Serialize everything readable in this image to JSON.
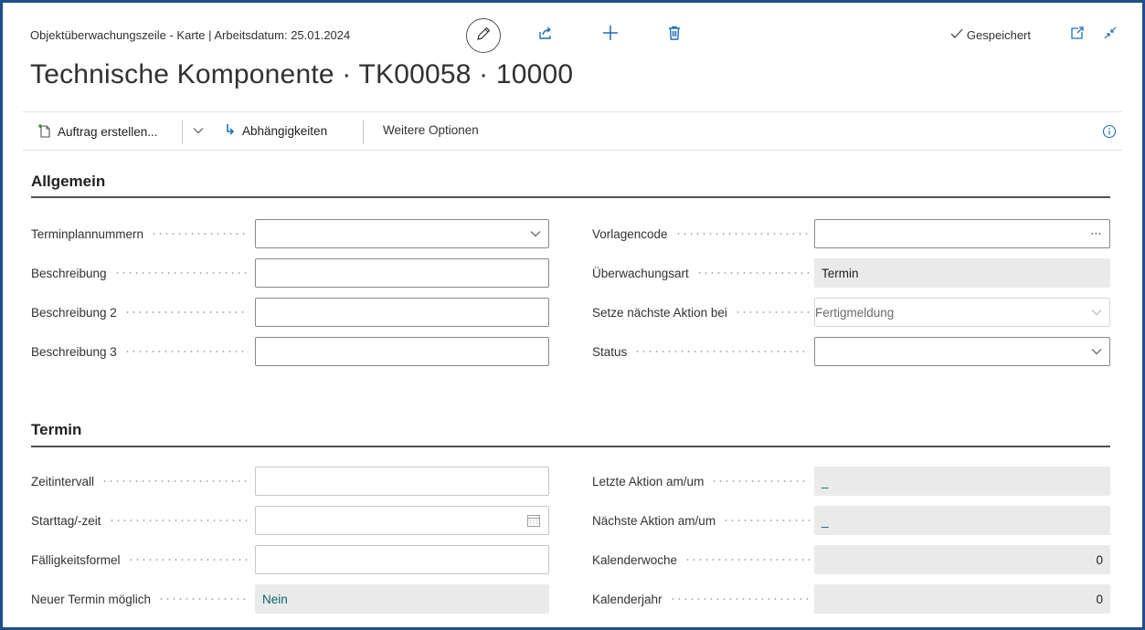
{
  "header": {
    "caption": "Objektüberwachungszeile - Karte | Arbeitsdatum: 25.01.2024",
    "saved_label": "Gespeichert",
    "title": "Technische Komponente · TK00058 · 10000"
  },
  "actions": {
    "create_order": "Auftrag erstellen...",
    "dependencies": "Abhängigkeiten",
    "more_options": "Weitere Optionen"
  },
  "general": {
    "title": "Allgemein",
    "schedule_plan_numbers": {
      "label": "Terminplannummern",
      "value": ""
    },
    "description": {
      "label": "Beschreibung",
      "value": ""
    },
    "description2": {
      "label": "Beschreibung 2",
      "value": ""
    },
    "description3": {
      "label": "Beschreibung 3",
      "value": ""
    },
    "template_code": {
      "label": "Vorlagencode",
      "value": ""
    },
    "monitoring_type": {
      "label": "Überwachungsart",
      "value": "Termin"
    },
    "next_action_at": {
      "label": "Setze nächste Aktion bei",
      "value": "Fertigmeldung"
    },
    "status": {
      "label": "Status",
      "value": ""
    }
  },
  "schedule": {
    "title": "Termin",
    "interval": {
      "label": "Zeitintervall",
      "value": ""
    },
    "start": {
      "label": "Starttag/-zeit",
      "value": ""
    },
    "due_formula": {
      "label": "Fälligkeitsformel",
      "value": ""
    },
    "new_date_possible": {
      "label": "Neuer Termin möglich",
      "value": "Nein"
    },
    "last_action": {
      "label": "Letzte Aktion am/um",
      "value": "_"
    },
    "next_action": {
      "label": "Nächste Aktion am/um",
      "value": "_"
    },
    "calendar_week": {
      "label": "Kalenderwoche",
      "value": "0"
    },
    "calendar_year": {
      "label": "Kalenderjahr",
      "value": "0"
    }
  },
  "colors": {
    "accent": "#1f4e8c",
    "teal": "#0a6372",
    "readonly_bg": "#eaeaea"
  },
  "icons": [
    "pencil-icon",
    "share-icon",
    "plus-icon",
    "delete-icon",
    "checkmark-icon",
    "open-new-window-icon",
    "collapse-icon",
    "new-document-icon",
    "chevron-down-icon",
    "dependencies-arrow-icon",
    "info-icon",
    "ellipsis-icon",
    "calendar-icon"
  ]
}
